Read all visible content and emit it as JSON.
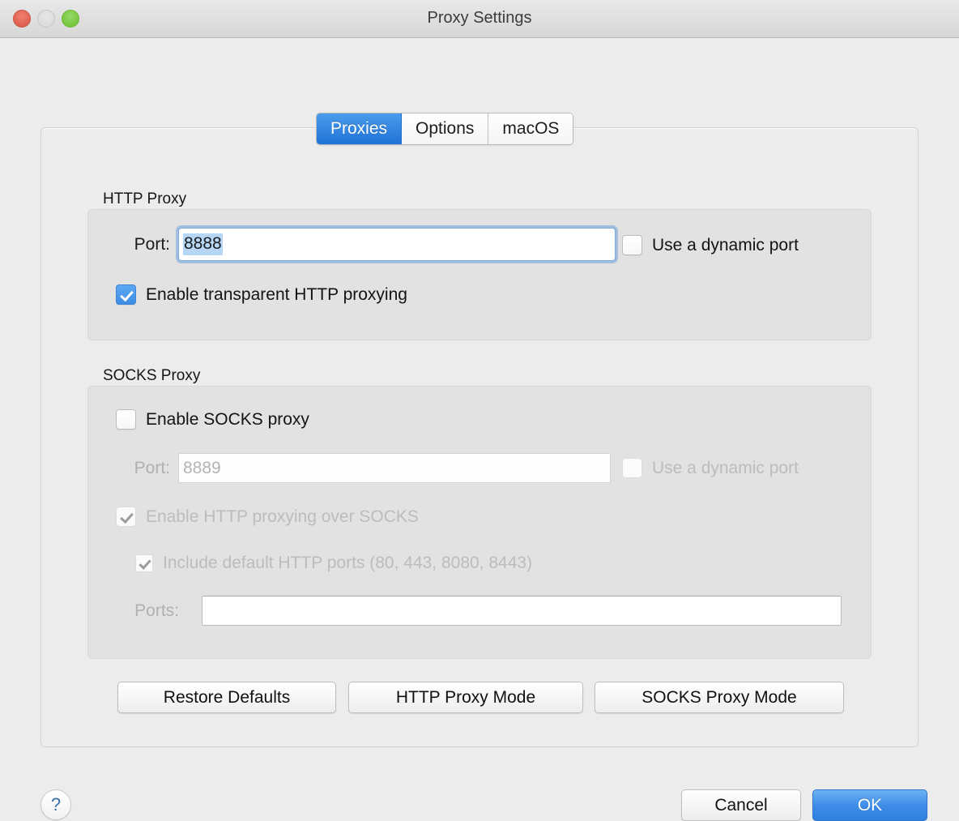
{
  "window": {
    "title": "Proxy Settings",
    "traffic_lights": [
      {
        "name": "close",
        "color": "#e0604f"
      },
      {
        "name": "minimize",
        "color": "#dcdcdc"
      },
      {
        "name": "zoom",
        "color": "#77c73f"
      }
    ]
  },
  "tabs": [
    {
      "label": "Proxies",
      "selected": true
    },
    {
      "label": "Options",
      "selected": false
    },
    {
      "label": "macOS",
      "selected": false
    }
  ],
  "http_proxy": {
    "group_label": "HTTP Proxy",
    "port_label": "Port:",
    "port_value": "8888",
    "port_focused": true,
    "dynamic_port_label": "Use a dynamic port",
    "dynamic_port_checked": false,
    "transparent_label": "Enable transparent HTTP proxying",
    "transparent_checked": true
  },
  "socks_proxy": {
    "group_label": "SOCKS Proxy",
    "enable_label": "Enable SOCKS proxy",
    "enable_checked": false,
    "port_label": "Port:",
    "port_value": "8889",
    "port_disabled": true,
    "dynamic_port_label": "Use a dynamic port",
    "dynamic_port_checked": false,
    "http_over_socks_label": "Enable HTTP proxying over SOCKS",
    "http_over_socks_checked": true,
    "default_ports_label": "Include default HTTP ports (80, 443, 8080, 8443)",
    "default_ports_checked": true,
    "ports_label": "Ports:",
    "ports_value": ""
  },
  "mode_buttons": {
    "restore_defaults": "Restore Defaults",
    "http_proxy_mode": "HTTP Proxy Mode",
    "socks_proxy_mode": "SOCKS Proxy Mode"
  },
  "footer": {
    "help": "?",
    "cancel": "Cancel",
    "ok": "OK"
  },
  "colors": {
    "accent_blue": "#3c8ce5",
    "selected_tab_blue": "#1f72d6",
    "selection_highlight": "#b6d6f6",
    "window_bg": "#ececec",
    "group_bg": "#e2e2e2",
    "help_glyph": "#3a6ea5"
  }
}
